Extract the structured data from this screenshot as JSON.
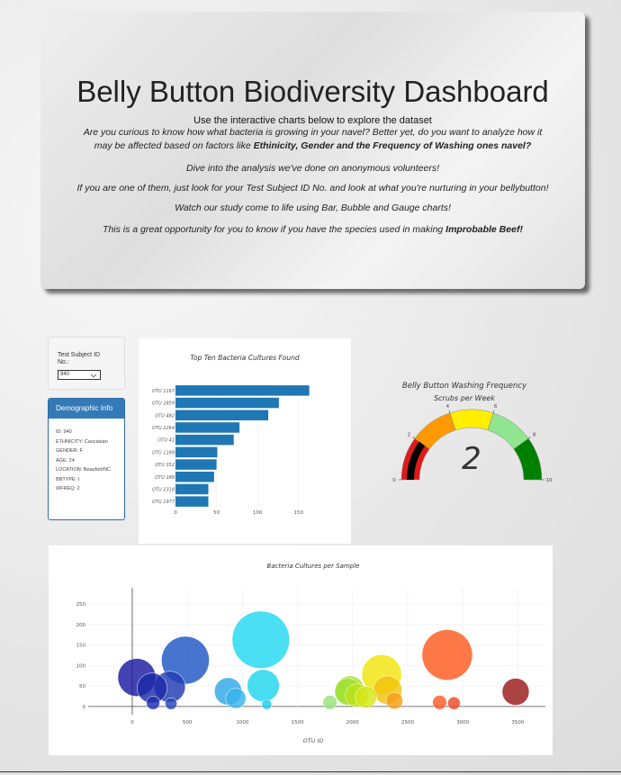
{
  "header": {
    "title": "Belly Button Biodiversity Dashboard",
    "subtitle": "Use the interactive charts below to explore the dataset",
    "para1_line1": "Are you curious to know how what bacteria is growing in your navel? Better yet, do you want to analyze how it",
    "para1_line2_start": "may be affected based on factors like ",
    "para1_line2_bold": "Ethinicity, Gender and the Frequency of Washing ones navel?",
    "para2": "Dive into the analysis we've done on anonymous volunteers!",
    "para3": "If you are one of them, just look for your Test Subject ID No. and look at what you're nurturing in your bellybutton!",
    "para4": "Watch our study come to life using Bar, Bubble and Gauge charts!",
    "para5_start": "This is a great opportunity for you to know if you have the species used in making ",
    "para5_bold": "Improbable Beef!"
  },
  "selector": {
    "label": "Test Subject ID No.:",
    "value": "940",
    "arrow_icon": "chevron-down-icon"
  },
  "demographics": {
    "title": "Demographic Info",
    "rows": [
      "ID: 940",
      "ETHNICITY: Caucasian",
      "GENDER: F",
      "AGE: 24",
      "LOCATION: Beaufort/NC",
      "BBTYPE: I",
      "WFREQ: 2"
    ]
  },
  "chart_data": [
    {
      "type": "bar",
      "orientation": "horizontal",
      "title": "Top Ten Bacteria Cultures Found",
      "categories": [
        "OTU 1167",
        "OTU 2859",
        "OTU 482",
        "OTU 2264",
        "OTU 41",
        "OTU 1189",
        "OTU 352",
        "OTU 189",
        "OTU 2318",
        "OTU 1977"
      ],
      "values": [
        163,
        126,
        113,
        78,
        71,
        51,
        50,
        47,
        40,
        40
      ],
      "xticks": [
        0,
        50,
        100,
        150
      ],
      "xlim": [
        0,
        170
      ],
      "color": "#1f77b4"
    },
    {
      "type": "gauge",
      "title": "Belly Button Washing Frequency",
      "subtitle": "Scrubs per Week",
      "value": 2,
      "range": [
        0,
        10
      ],
      "ticks": [
        0,
        2,
        4,
        6,
        8,
        10
      ],
      "bands": [
        {
          "from": 0,
          "to": 2,
          "color": "#e01a1a"
        },
        {
          "from": 2,
          "to": 4,
          "color": "#ff9900"
        },
        {
          "from": 4,
          "to": 6,
          "color": "#ffee00"
        },
        {
          "from": 6,
          "to": 8,
          "color": "#8fe68f"
        },
        {
          "from": 8,
          "to": 10,
          "color": "#008000"
        }
      ],
      "bar_color": "#000000"
    },
    {
      "type": "scatter",
      "subtype": "bubble",
      "title": "Bacteria Cultures per Sample",
      "xlabel": "OTU ID",
      "xticks": [
        0,
        500,
        1000,
        1500,
        2000,
        2500,
        3000,
        3500
      ],
      "yticks": [
        0,
        50,
        100,
        150,
        200,
        250
      ],
      "xlim": [
        -400,
        3750
      ],
      "ylim": [
        -20,
        290
      ],
      "points": [
        {
          "x": 41,
          "y": 71,
          "color": "#1a1aa0"
        },
        {
          "x": 180,
          "y": 45,
          "color": "#1c2aa8"
        },
        {
          "x": 189,
          "y": 9,
          "color": "#2030b0"
        },
        {
          "x": 340,
          "y": 48,
          "color": "#1e3ab2"
        },
        {
          "x": 352,
          "y": 7,
          "color": "#2a44b8"
        },
        {
          "x": 482,
          "y": 113,
          "color": "#1e56c4"
        },
        {
          "x": 870,
          "y": 37,
          "color": "#2fa8e8"
        },
        {
          "x": 940,
          "y": 20,
          "color": "#38b4ec"
        },
        {
          "x": 1167,
          "y": 163,
          "color": "#22d8f0"
        },
        {
          "x": 1189,
          "y": 51,
          "color": "#20d4ee"
        },
        {
          "x": 1220,
          "y": 5,
          "color": "#22ccea"
        },
        {
          "x": 1795,
          "y": 10,
          "color": "#9be07a"
        },
        {
          "x": 1960,
          "y": 36,
          "color": "#9de035"
        },
        {
          "x": 1977,
          "y": 40,
          "color": "#a8e020"
        },
        {
          "x": 2040,
          "y": 27,
          "color": "#bde21a"
        },
        {
          "x": 2120,
          "y": 23,
          "color": "#d6e61a"
        },
        {
          "x": 2264,
          "y": 78,
          "color": "#f2e40a"
        },
        {
          "x": 2318,
          "y": 40,
          "color": "#f3c20e"
        },
        {
          "x": 2380,
          "y": 14,
          "color": "#f5a018"
        },
        {
          "x": 2859,
          "y": 126,
          "color": "#ff5a1e"
        },
        {
          "x": 2790,
          "y": 10,
          "color": "#fa5a2a"
        },
        {
          "x": 2920,
          "y": 8,
          "color": "#ee4a2a"
        },
        {
          "x": 3480,
          "y": 36,
          "color": "#9a1a1a"
        }
      ]
    }
  ]
}
